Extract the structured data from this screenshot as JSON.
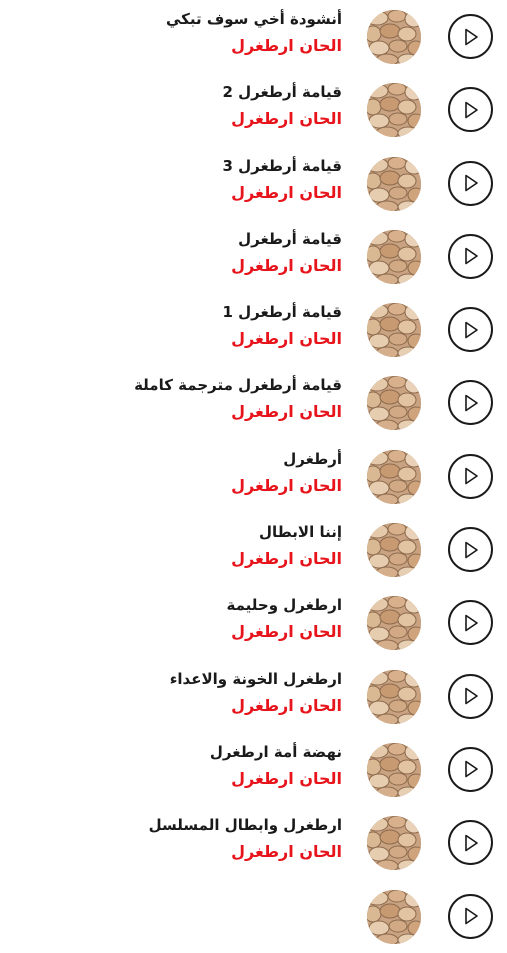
{
  "colors": {
    "title": "#1a1a1a",
    "subtitle": "#e8141b",
    "play_border": "#1a1a1a",
    "background": "#ffffff"
  },
  "icons": {
    "play": "play-icon",
    "thumbnail": "stone-wall-thumbnail"
  },
  "tracks": [
    {
      "title": "أنشودة أخي سوف تبكي",
      "subtitle": "الحان ارطغرل"
    },
    {
      "title": "قيامة أرطغرل 2",
      "subtitle": "الحان ارطغرل"
    },
    {
      "title": "قيامة أرطغرل 3",
      "subtitle": "الحان ارطغرل"
    },
    {
      "title": "قيامة أرطغرل",
      "subtitle": "الحان ارطغرل"
    },
    {
      "title": "قيامة أرطغرل 1",
      "subtitle": "الحان ارطغرل"
    },
    {
      "title": "قيامة أرطغرل  مترجمة كاملة",
      "subtitle": "الحان ارطغرل"
    },
    {
      "title": "أرطغرل",
      "subtitle": "الحان ارطغرل"
    },
    {
      "title": "إننا الابطال",
      "subtitle": "الحان ارطغرل"
    },
    {
      "title": "ارطغرل وحليمة",
      "subtitle": "الحان ارطغرل"
    },
    {
      "title": "ارطغرل الخونة والاعداء",
      "subtitle": "الحان ارطغرل"
    },
    {
      "title": "نهضة أمة ارطغرل",
      "subtitle": "الحان ارطغرل"
    },
    {
      "title": "ارطغرل وابطال المسلسل",
      "subtitle": "الحان ارطغرل"
    },
    {
      "title": "",
      "subtitle": ""
    }
  ]
}
